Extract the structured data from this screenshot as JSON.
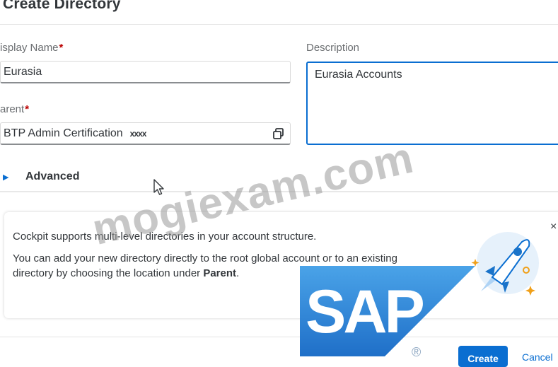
{
  "dialog": {
    "title": "Create Directory"
  },
  "form": {
    "display_name_label": "isplay Name",
    "display_name_value": "Eurasia",
    "parent_label": "arent",
    "parent_value": "BTP Admin Certification",
    "parent_mask": "xxxx",
    "description_label": "Description",
    "description_value": "Eurasia Accounts",
    "required_marker": "*"
  },
  "advanced": {
    "label": "Advanced"
  },
  "info": {
    "line1": "Cockpit supports multi-level directories in your account structure.",
    "line2": "You can add your new directory directly to the root global account or to an existing",
    "line3_prefix": "directory by choosing the location under ",
    "line3_bold": "Parent",
    "line3_suffix": ".",
    "close_glyph": "×"
  },
  "footer": {
    "create_label": "Create",
    "cancel_label": "Cancel"
  },
  "overlay": {
    "watermark_text": "mogiexam.com",
    "logo_text": "SAP",
    "logo_mark": "®"
  },
  "colors": {
    "accent": "#0a6ed1",
    "required": "#bb0000",
    "text": "#32363a",
    "muted": "#6a6d70"
  },
  "icons": [
    "copy-icon",
    "expand-caret-icon",
    "mouse-pointer-icon",
    "rocket-illustration",
    "close-icon"
  ]
}
